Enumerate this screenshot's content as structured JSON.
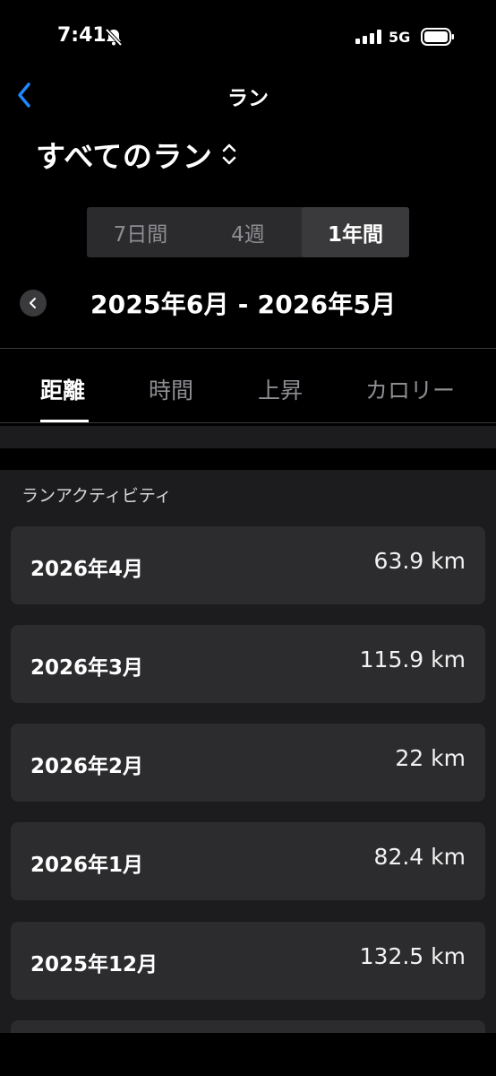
{
  "status": {
    "time": "7:41",
    "network": "5G"
  },
  "nav": {
    "title": "ラン",
    "filter": "すべてのラン"
  },
  "periods": [
    {
      "label": "7日間",
      "active": false
    },
    {
      "label": "4週",
      "active": false
    },
    {
      "label": "1年間",
      "active": true
    }
  ],
  "date_range": "2025年6月 - 2026年5月",
  "metric_tabs": [
    {
      "label": "距離",
      "active": true
    },
    {
      "label": "時間",
      "active": false
    },
    {
      "label": "上昇",
      "active": false
    },
    {
      "label": "カロリー",
      "active": false
    }
  ],
  "section_title": "ランアクティビティ",
  "activities": [
    {
      "month": "2026年4月",
      "distance": "63.9 km"
    },
    {
      "month": "2026年3月",
      "distance": "115.9 km"
    },
    {
      "month": "2026年2月",
      "distance": "22 km"
    },
    {
      "month": "2026年1月",
      "distance": "82.4 km"
    },
    {
      "month": "2025年12月",
      "distance": "132.5 km"
    }
  ],
  "icons": {
    "back": "chevron-left-icon",
    "filter": "chevron-updown-icon",
    "prev": "chevron-left-icon",
    "status": [
      "bell-slash-icon",
      "signal-icon",
      "battery-icon"
    ]
  },
  "colors": {
    "accent": "#1e88ff",
    "background": "#000000",
    "card": "#2c2c2e"
  }
}
